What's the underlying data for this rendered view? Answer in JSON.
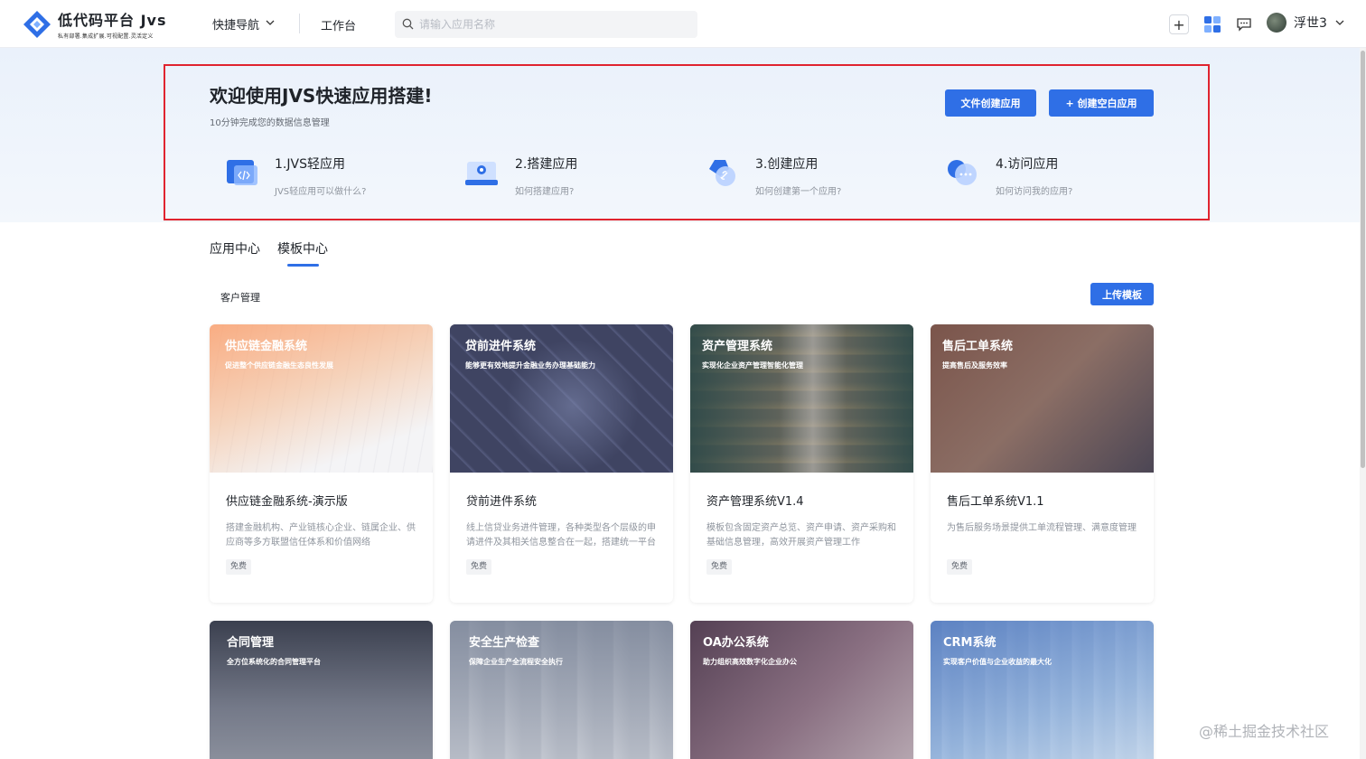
{
  "header": {
    "logo_title": "低代码平台 Jvs",
    "logo_subtitle": "私有部署.集成扩展.可视配置.灵活定义",
    "quick_nav": "快捷导航",
    "workbench": "工作台",
    "search_placeholder": "请输入应用名称",
    "user_name": "浮世3"
  },
  "hero": {
    "title": "欢迎使用JVS快速应用搭建!",
    "subtitle": "10分钟完成您的数据信息管理",
    "file_create_button": "文件创建应用",
    "blank_create_button": "+ 创建空白应用",
    "steps": [
      {
        "title": "1.JVS轻应用",
        "desc": "JVS轻应用可以做什么?"
      },
      {
        "title": "2.搭建应用",
        "desc": "如何搭建应用?"
      },
      {
        "title": "3.创建应用",
        "desc": "如何创建第一个应用?"
      },
      {
        "title": "4.访问应用",
        "desc": "如何访问我的应用?"
      }
    ]
  },
  "tabs": [
    {
      "label": "应用中心",
      "active": false
    },
    {
      "label": "模板中心",
      "active": true
    }
  ],
  "category": "客户管理",
  "upload_button": "上传模板",
  "cards": [
    {
      "img_title": "供应链金融系统",
      "img_subtitle": "促进整个供应链金融生态良性发展",
      "name": "供应链金融系统-演示版",
      "desc": "搭建金融机构、产业链核心企业、链属企业、供应商等多方联盟信任体系和价值网络",
      "badge": "免费"
    },
    {
      "img_title": "贷前进件系统",
      "img_subtitle": "能够更有效地提升金融业务办理基础能力",
      "name": "贷前进件系统",
      "desc": "线上信贷业务进件管理，各种类型各个层级的申请进件及其相关信息整合在一起，搭建统一平台",
      "badge": "免费"
    },
    {
      "img_title": "资产管理系统",
      "img_subtitle": "实现化企业资产管理智能化管理",
      "name": "资产管理系统V1.4",
      "desc": "模板包含固定资产总览、资产申请、资产采购和基础信息管理，高效开展资产管理工作",
      "badge": "免费"
    },
    {
      "img_title": "售后工单系统",
      "img_subtitle": "提高售后及服务效率",
      "name": "售后工单系统V1.1",
      "desc": "为售后服务场景提供工单流程管理、满意度管理",
      "badge": "免费"
    },
    {
      "img_title": "合同管理",
      "img_subtitle": "全方位系统化的合同管理平台"
    },
    {
      "img_title": "安全生产检查",
      "img_subtitle": "保障企业生产全流程安全执行"
    },
    {
      "img_title": "OA办公系统",
      "img_subtitle": "助力组织高效数字化企业办公"
    },
    {
      "img_title": "CRM系统",
      "img_subtitle": "实现客户价值与企业收益的最大化"
    }
  ],
  "watermark": "@稀土掘金技术社区",
  "colors": {
    "primary": "#2f6fe6",
    "highlight_border": "#e0242f"
  }
}
